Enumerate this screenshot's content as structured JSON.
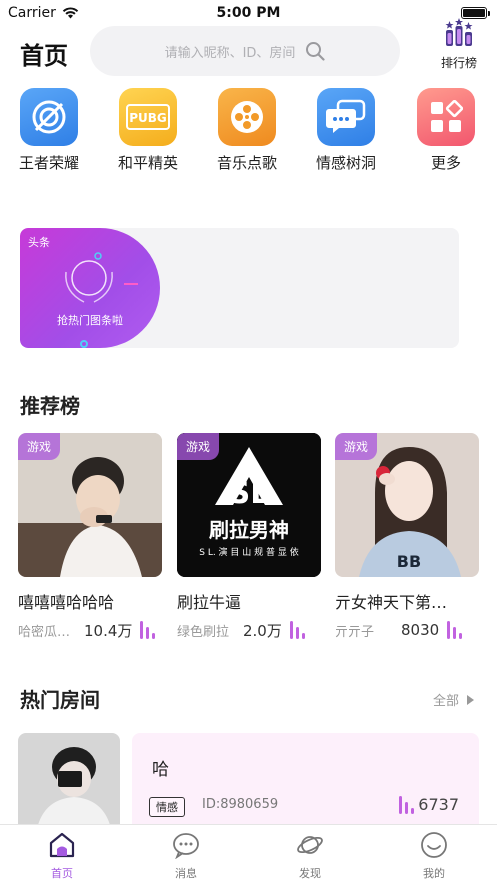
{
  "status_bar": {
    "carrier": "Carrier",
    "time": "5:00 PM"
  },
  "header": {
    "title": "首页",
    "search_placeholder": "请输入昵称、ID、房间",
    "rank_label": "排行榜"
  },
  "categories": [
    {
      "label": "王者荣耀",
      "icon": "honor-of-kings-icon",
      "color": "#3a8bf0"
    },
    {
      "label": "和平精英",
      "icon": "pubg-icon",
      "color": "#f5b82a"
    },
    {
      "label": "音乐点歌",
      "icon": "music-reel-icon",
      "color": "#f39a28"
    },
    {
      "label": "情感树洞",
      "icon": "chat-bubbles-icon",
      "color": "#3a8bf0"
    },
    {
      "label": "更多",
      "icon": "grid-more-icon",
      "color": "#f26a7c"
    }
  ],
  "banner": {
    "tag": "头条",
    "text": "抢热门图条啦"
  },
  "recommend": {
    "title": "推荐榜",
    "items": [
      {
        "tag": "游戏",
        "name": "嘻嘻嘻哈哈哈",
        "sub": "哈密瓜…",
        "count": "10.4万"
      },
      {
        "tag": "游戏",
        "name": "刷拉牛逼",
        "sub": "绿色刷拉",
        "count": "2.0万",
        "logo_text": "刷拉男神",
        "logo_sub": "S L. 演 目 山 规 普 显 依"
      },
      {
        "tag": "游戏",
        "name": "亓女神天下第…",
        "sub": "亓亓子",
        "count": "8030"
      }
    ]
  },
  "hot_rooms": {
    "title": "热门房间",
    "more": "全部",
    "items": [
      {
        "title": "哈",
        "tag": "情感",
        "id": "ID:8980659",
        "count": "6737"
      }
    ]
  },
  "tabs": [
    {
      "label": "首页",
      "icon": "home-icon",
      "active": true
    },
    {
      "label": "消息",
      "icon": "message-icon",
      "active": false
    },
    {
      "label": "发现",
      "icon": "planet-icon",
      "active": false
    },
    {
      "label": "我的",
      "icon": "smile-icon",
      "active": false
    }
  ],
  "colors": {
    "accent": "#a45be0",
    "bars": "#c162e0"
  }
}
